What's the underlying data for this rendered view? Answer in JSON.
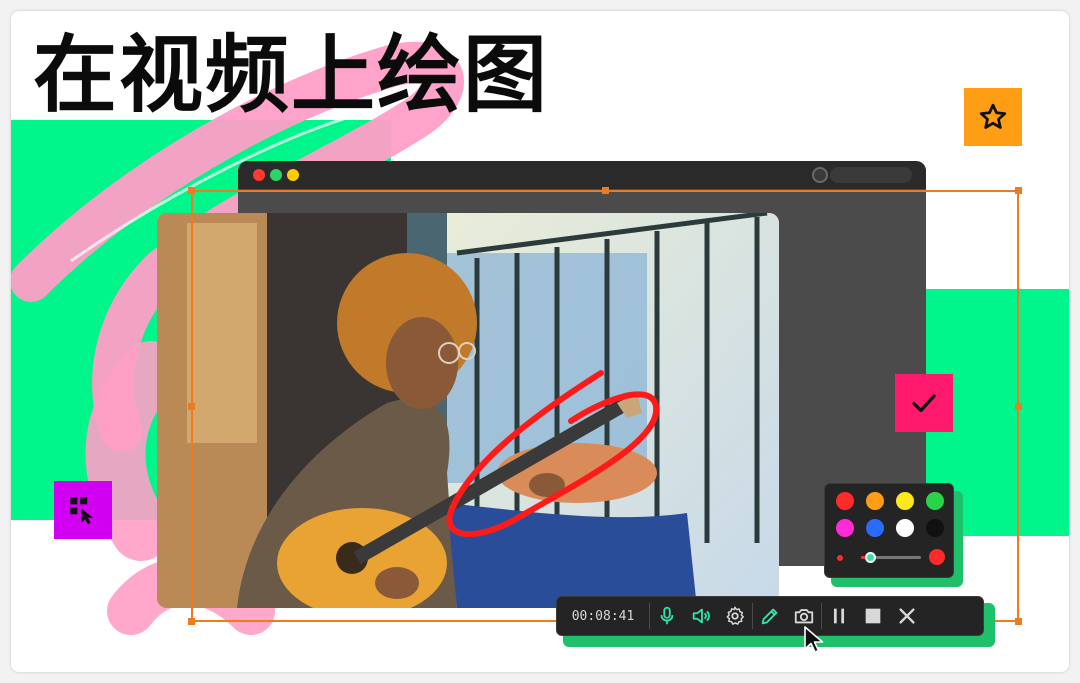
{
  "headline": {
    "text": "在视频上绘图"
  },
  "recorder": {
    "timer": "00:08:41",
    "buttons": [
      "microphone-icon",
      "speaker-icon",
      "gear-icon",
      "pencil-icon",
      "camera-icon",
      "pause-icon",
      "stop-icon",
      "close-icon"
    ]
  },
  "palette": {
    "colors": [
      "#ff2b2b",
      "#ff9d14",
      "#ffe81a",
      "#2ad44a",
      "#ff2bd8",
      "#2b6bff",
      "#ffffff",
      "#111111"
    ],
    "brush_size_fraction": 0.15
  },
  "badges": {
    "star_color": "#ff9d14",
    "check_color": "#ff1a6d",
    "cursor_color": "#d200f0"
  },
  "colors": {
    "accent_green": "#00f58a",
    "selection_orange": "#f07a1e",
    "annotation_red": "#ff1a1a"
  }
}
